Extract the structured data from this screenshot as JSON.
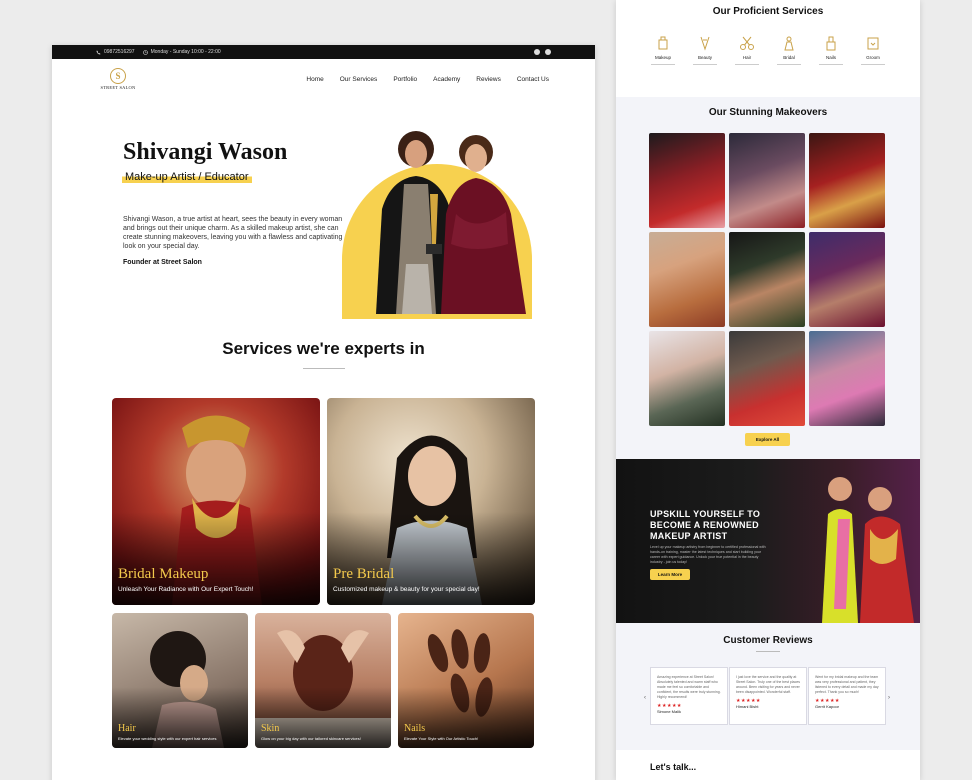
{
  "left": {
    "topbar": {
      "phone": "09872516297",
      "hours": "Monday - Sunday 10:00 - 22:00"
    },
    "logo": {
      "mark": "S",
      "text": "STREET SALON"
    },
    "nav": [
      "Home",
      "Our Services",
      "Portfolio",
      "Academy",
      "Reviews",
      "Contact Us"
    ],
    "hero": {
      "name": "Shivangi Wason",
      "role": "Make-up Artist / Educator",
      "bio": "Shivangi Wason, a true artist at heart, sees the beauty in every woman and brings out their unique charm. As a skilled makeup artist, she can create stunning makeovers, leaving you with a flawless and captivating look on your special day.",
      "founder": "Founder at Street Salon"
    },
    "services_heading": "Services we're experts in",
    "services": [
      {
        "title": "Bridal Makeup",
        "subtitle": "Unleash Your Radiance with Our Expert Touch!"
      },
      {
        "title": "Pre Bridal",
        "subtitle": "Customized makeup & beauty for your special day!"
      },
      {
        "title": "Hair",
        "subtitle": "Elevate your wedding style with our expert hair services"
      },
      {
        "title": "Skin",
        "subtitle": "Glow on your big day with our tailored skincare services!"
      },
      {
        "title": "Nails",
        "subtitle": "Elevate Your Style with Our Artistic Touch!"
      }
    ]
  },
  "right": {
    "services_heading": "Our Proficient Services",
    "services": [
      {
        "label": "Makeup",
        "icon": "makeup-icon"
      },
      {
        "label": "Beauty",
        "icon": "beauty-icon"
      },
      {
        "label": "Hair",
        "icon": "scissors-icon"
      },
      {
        "label": "Bridal",
        "icon": "bridal-icon"
      },
      {
        "label": "Nails",
        "icon": "nail-polish-icon"
      },
      {
        "label": "Groom",
        "icon": "groom-icon"
      }
    ],
    "makeovers_heading": "Our Stunning Makeovers",
    "explore_label": "Explore All",
    "upskill": {
      "heading": "UPSKILL YOURSELF TO BECOME A RENOWNED MAKEUP ARTIST",
      "text": "Level up your makeup artistry from beginner to certified professional with hands-on training, master the latest techniques and start building your career with expert guidance. Unlock your true potential in the beauty industry - join us today!",
      "button": "Learn More"
    },
    "reviews_heading": "Customer Reviews",
    "reviews": [
      {
        "text": "Amazing experience at Street Salon! Absolutely talented and warm staff who made me feel so comfortable and confident, the results were truly stunning. Highly recommend!",
        "stars": "★★★★★",
        "name": "Simone Malik"
      },
      {
        "text": "I just love the service and the quality at Street Salon. Truly one of the best places around. Been visiting for years and never been disappointed. Wonderful staff.",
        "stars": "★★★★★",
        "name": "Himani Bisht"
      },
      {
        "text": "Went for my bridal makeup and the team was very professional and patient, they listened to every detail and made my day perfect. Thank you so much!",
        "stars": "★★★★★",
        "name": "Gerrit Kapoor"
      }
    ],
    "talk_heading": "Let's talk..."
  },
  "colors": {
    "accent": "#f7d14f",
    "gold": "#c9a24a",
    "dark": "#111111"
  }
}
